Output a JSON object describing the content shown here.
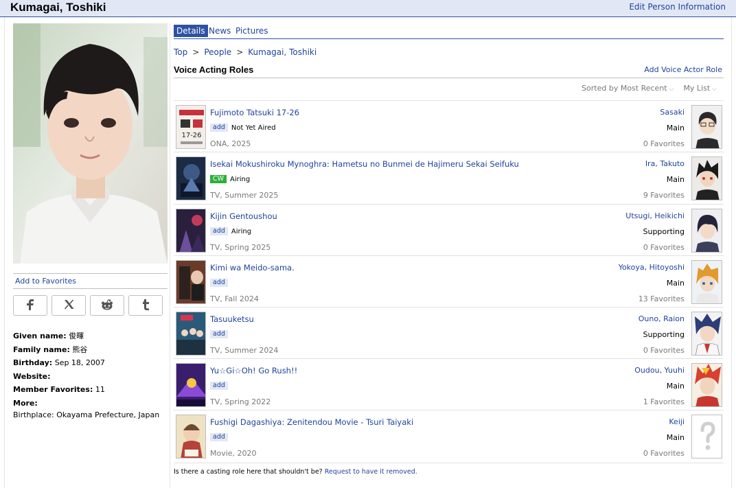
{
  "header": {
    "title": "Kumagai, Toshiki",
    "edit_link": "Edit Person Information"
  },
  "sidebar": {
    "add_favorites": "Add to Favorites",
    "share_icons": [
      "facebook-icon",
      "x-icon",
      "reddit-icon",
      "tumblr-icon"
    ],
    "info": {
      "given_name_label": "Given name:",
      "given_name": "俊暉",
      "family_name_label": "Family name:",
      "family_name": "熊谷",
      "birthday_label": "Birthday:",
      "birthday": "Sep 18, 2007",
      "website_label": "Website:",
      "member_favorites_label": "Member Favorites:",
      "member_favorites": "11",
      "more_label": "More:",
      "birthplace": "Birthplace: Okayama Prefecture, Japan"
    }
  },
  "tabs": [
    {
      "label": "Details",
      "active": true
    },
    {
      "label": "News",
      "active": false
    },
    {
      "label": "Pictures",
      "active": false
    }
  ],
  "breadcrumb": {
    "items": [
      "Top",
      "People",
      "Kumagai, Toshiki"
    ],
    "separator": ">"
  },
  "section": {
    "title": "Voice Acting Roles",
    "add_link": "Add Voice Actor Role",
    "sort_label": "Sorted by Most Recent",
    "list_label": "My List"
  },
  "roles": [
    {
      "anime": "Fujimoto Tatsuki 17-26",
      "badge": "add",
      "status": "Not Yet Aired",
      "meta": "ONA, 2025",
      "character": "Sasaki",
      "role": "Main",
      "favorites": "0 Favorites"
    },
    {
      "anime": "Isekai Mokushiroku Mynoghra: Hametsu no Bunmei de Hajimeru Sekai Seifuku",
      "badge": "CW",
      "status": "Airing",
      "meta": "TV, Summer 2025",
      "character": "Ira, Takuto",
      "role": "Main",
      "favorites": "9 Favorites"
    },
    {
      "anime": "Kijin Gentoushou",
      "badge": "add",
      "status": "Airing",
      "meta": "TV, Spring 2025",
      "character": "Utsugi, Heikichi",
      "role": "Supporting",
      "favorites": "0 Favorites"
    },
    {
      "anime": "Kimi wa Meido-sama.",
      "badge": "add",
      "status": "",
      "meta": "TV, Fall 2024",
      "character": "Yokoya, Hitoyoshi",
      "role": "Main",
      "favorites": "13 Favorites"
    },
    {
      "anime": "Tasuuketsu",
      "badge": "add",
      "status": "",
      "meta": "TV, Summer 2024",
      "character": "Ouno, Raion",
      "role": "Supporting",
      "favorites": "0 Favorites"
    },
    {
      "anime": "Yu☆Gi☆Oh! Go Rush!!",
      "badge": "add",
      "status": "",
      "meta": "TV, Spring 2022",
      "character": "Oudou, Yuuhi",
      "role": "Main",
      "favorites": "1 Favorites"
    },
    {
      "anime": "Fushigi Dagashiya: Zenitendou Movie - Tsuri Taiyaki",
      "badge": "add",
      "status": "",
      "meta": "Movie, 2020",
      "character": "Keiji",
      "role": "Main",
      "favorites": "0 Favorites"
    }
  ],
  "footer": {
    "question": "Is there a casting role here that shouldn't be?",
    "request_link": "Request to have it removed."
  },
  "colors": {
    "header_bg": "#e1e7f5",
    "accent": "#2e51a2",
    "link": "#1d439b",
    "cw_green": "#2db039"
  }
}
